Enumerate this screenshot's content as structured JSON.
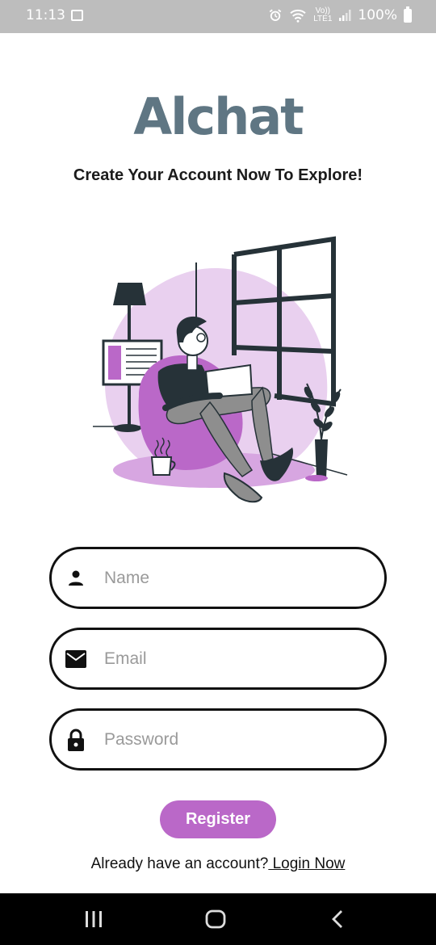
{
  "status_bar": {
    "time": "11:13",
    "network_label_top": "Vo))",
    "network_label_bottom": "LTE1",
    "battery_percent": "100%"
  },
  "header": {
    "app_name": "Alchat",
    "subtitle": "Create Your Account Now To Explore!"
  },
  "form": {
    "name_placeholder": "Name",
    "email_placeholder": "Email",
    "password_placeholder": "Password",
    "register_label": "Register"
  },
  "footer": {
    "prompt": "Already have an account?",
    "login_link": " Login Now"
  },
  "colors": {
    "accent": "#ba68c8",
    "logo": "#5f7683",
    "status_bar": "#bdbdbd"
  },
  "icons": [
    "person-icon",
    "mail-icon",
    "lock-icon",
    "alarm-icon",
    "wifi-icon",
    "signal-icon",
    "battery-icon"
  ]
}
